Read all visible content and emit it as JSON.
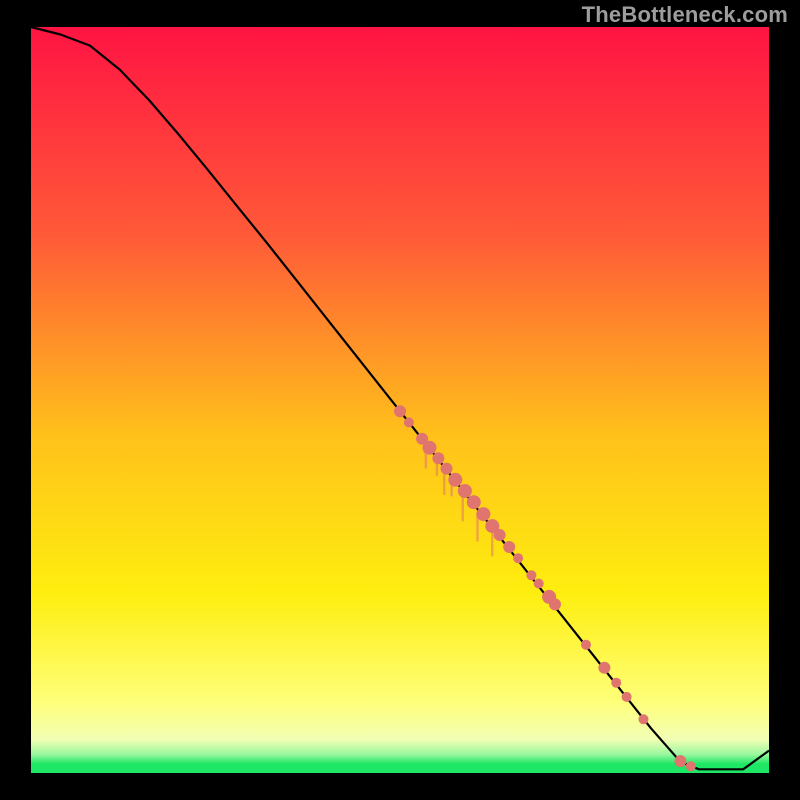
{
  "watermark": "TheBottleneck.com",
  "colors": {
    "frame": "#000000",
    "curve": "#000000",
    "point": "#e0746e",
    "grad_top": "#ff1443",
    "grad_orange": "#ff7a34",
    "grad_yellow": "#feee0f",
    "grad_pale": "#f2ffb4",
    "grad_green": "#1de765"
  },
  "chart_data": {
    "type": "line",
    "title": "",
    "xlabel": "",
    "ylabel": "",
    "xlim": [
      0,
      100
    ],
    "ylim": [
      0,
      100
    ],
    "curve": {
      "x": [
        0,
        4,
        8,
        12,
        16,
        20,
        24,
        28,
        32,
        36,
        40,
        44,
        48,
        52,
        56,
        60,
        64,
        68,
        72,
        76,
        80,
        84,
        88,
        90.5,
        96.5,
        100
      ],
      "y": [
        100,
        99,
        97.5,
        94.3,
        90.2,
        85.6,
        80.8,
        75.9,
        71.0,
        66.0,
        61.0,
        56.0,
        51.0,
        46.0,
        41.0,
        36.0,
        31.0,
        26.0,
        21.0,
        16.0,
        11.0,
        6.0,
        1.5,
        0.5,
        0.5,
        3.0
      ]
    },
    "series": [
      {
        "name": "points",
        "points": [
          {
            "x": 50.0,
            "y": 48.5,
            "r": 6
          },
          {
            "x": 51.2,
            "y": 47.0,
            "r": 5
          },
          {
            "x": 53.0,
            "y": 44.8,
            "r": 6
          },
          {
            "x": 54.0,
            "y": 43.6,
            "r": 7
          },
          {
            "x": 55.2,
            "y": 42.2,
            "r": 6
          },
          {
            "x": 56.3,
            "y": 40.8,
            "r": 6
          },
          {
            "x": 57.5,
            "y": 39.3,
            "r": 7
          },
          {
            "x": 58.8,
            "y": 37.8,
            "r": 7
          },
          {
            "x": 60.0,
            "y": 36.3,
            "r": 7
          },
          {
            "x": 61.3,
            "y": 34.7,
            "r": 7
          },
          {
            "x": 62.5,
            "y": 33.1,
            "r": 7
          },
          {
            "x": 63.5,
            "y": 31.9,
            "r": 6
          },
          {
            "x": 64.8,
            "y": 30.3,
            "r": 6
          },
          {
            "x": 66.0,
            "y": 28.8,
            "r": 5
          },
          {
            "x": 67.8,
            "y": 26.5,
            "r": 5
          },
          {
            "x": 68.8,
            "y": 25.4,
            "r": 5
          },
          {
            "x": 70.2,
            "y": 23.6,
            "r": 7
          },
          {
            "x": 71.0,
            "y": 22.6,
            "r": 6
          },
          {
            "x": 75.2,
            "y": 17.2,
            "r": 5
          },
          {
            "x": 77.7,
            "y": 14.1,
            "r": 6
          },
          {
            "x": 79.3,
            "y": 12.1,
            "r": 5
          },
          {
            "x": 80.7,
            "y": 10.2,
            "r": 5
          },
          {
            "x": 83.0,
            "y": 7.2,
            "r": 5
          },
          {
            "x": 88.0,
            "y": 1.6,
            "r": 6
          },
          {
            "x": 89.4,
            "y": 0.9,
            "r": 5
          }
        ]
      }
    ]
  }
}
